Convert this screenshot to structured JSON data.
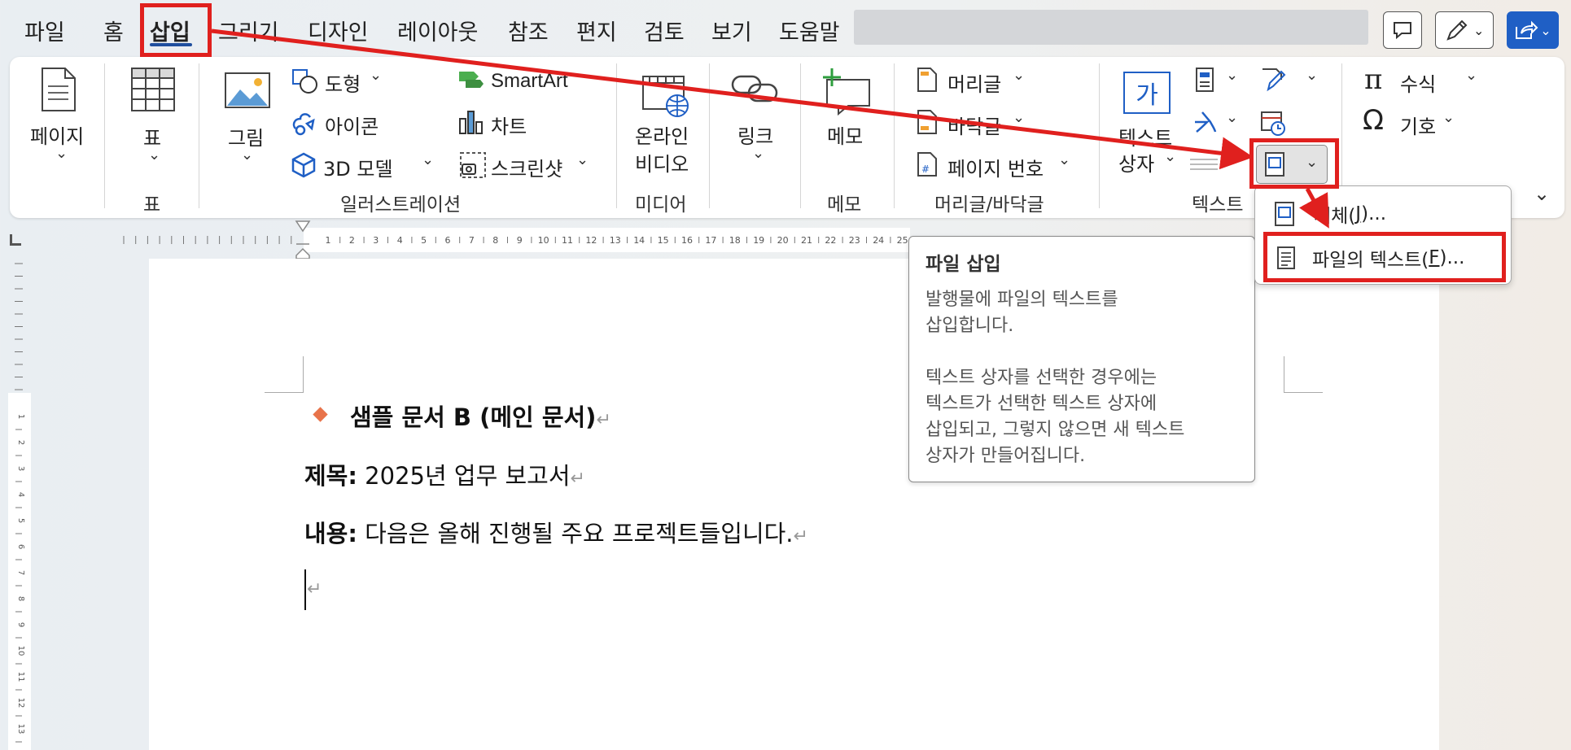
{
  "menu": {
    "tabs": [
      "파일",
      "홈",
      "삽입",
      "그리기",
      "디자인",
      "레이아웃",
      "참조",
      "편지",
      "검토",
      "보기",
      "도움말"
    ],
    "active": "삽입"
  },
  "ribbon": {
    "page": "페이지",
    "table": "표",
    "table_group": "표",
    "picture": "그림",
    "shapes": "도형",
    "icons": "아이콘",
    "models3d": "3D 모델",
    "smartart": "SmartArt",
    "chart": "차트",
    "screenshot": "스크린샷",
    "illustrations_group": "일러스트레이션",
    "online_video_1": "온라인",
    "online_video_2": "비디오",
    "media_group": "미디어",
    "link": "링크",
    "comment": "메모",
    "comment_group": "메모",
    "header": "머리글",
    "footer": "바닥글",
    "page_number": "페이지 번호",
    "header_footer_group": "머리글/바닥글",
    "textbox_1": "텍스트",
    "textbox_2": "상자",
    "textbox_icon_char": "가",
    "text_group": "텍스트",
    "equation": "수식",
    "symbol": "기호",
    "pi": "π",
    "omega": "Ω"
  },
  "ruler": {
    "numbers": [
      "1",
      "2",
      "3",
      "4",
      "5",
      "6",
      "7",
      "8",
      "9",
      "10",
      "11",
      "12",
      "13",
      "14",
      "15",
      "16",
      "17",
      "18",
      "19",
      "20",
      "21",
      "22",
      "23",
      "24",
      "25"
    ],
    "vnumbers": [
      "1",
      "2",
      "3",
      "4",
      "5",
      "6",
      "7",
      "8",
      "9",
      "10",
      "11",
      "12",
      "13"
    ]
  },
  "document": {
    "heading": "샘플 문서 B (메인 문서)",
    "title_label": "제목:",
    "title_value": " 2025년 업무 보고서",
    "content_label": "내용:",
    "content_value": " 다음은 올해 진행될 주요 프로젝트들입니다.",
    "pmark": "↵"
  },
  "tooltip": {
    "title": "파일 삽입",
    "line1": "발행물에 파일의 텍스트를",
    "line2": "삽입합니다.",
    "line3": "텍스트 상자를 선택한 경우에는",
    "line4": "텍스트가 선택한 텍스트 상자에",
    "line5": "삽입되고, 그렇지 않으면 새 텍스트",
    "line6": "상자가 만들어집니다."
  },
  "dropdown": {
    "item1_label": "개체(",
    "item1_key": "J",
    "item1_end": ")...",
    "item2_label": "파일의 텍스트(",
    "item2_key": "F",
    "item2_end": ")..."
  },
  "colors": {
    "accent": "#1f4e9e",
    "annotation": "#e0201e",
    "bullet": "#e8734a",
    "share": "#1f5fc5"
  }
}
